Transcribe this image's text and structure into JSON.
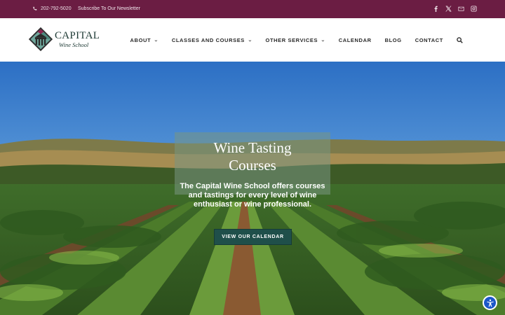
{
  "topbar": {
    "phone": "202-792-5020",
    "newsletter": "Subscribe To Our Newsletter",
    "social": [
      "facebook-icon",
      "x-icon",
      "mail-icon",
      "instagram-icon"
    ]
  },
  "logo": {
    "title": "CAPITAL",
    "subtitle": "Wine School"
  },
  "nav": {
    "items": [
      {
        "label": "ABOUT",
        "dropdown": true
      },
      {
        "label": "CLASSES AND COURSES",
        "dropdown": true
      },
      {
        "label": "OTHER SERVICES",
        "dropdown": true
      },
      {
        "label": "CALENDAR",
        "dropdown": false
      },
      {
        "label": "BLOG",
        "dropdown": false
      },
      {
        "label": "CONTACT",
        "dropdown": false
      }
    ]
  },
  "hero": {
    "title_line1": "Wine Tasting",
    "title_line2": "Courses",
    "description": "The Capital Wine School offers courses and tastings for every level of wine enthusiast or wine professional.",
    "cta": "VIEW OUR CALENDAR"
  },
  "colors": {
    "topbar": "#6b1d43",
    "cta": "#1f4f4a",
    "accessibility": "#1c57c9"
  }
}
